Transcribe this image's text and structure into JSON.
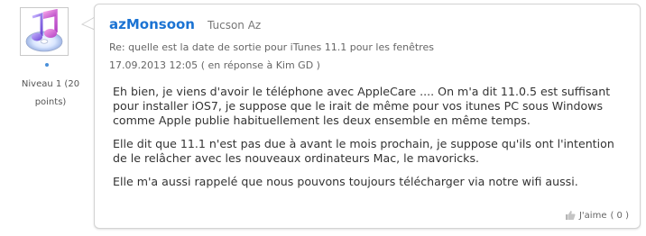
{
  "user": {
    "name": "azMonsoon",
    "location": "Tucson Az",
    "level": "Niveau 1 (20 points)",
    "avatar_icon": "music-notes-icon"
  },
  "post": {
    "subject": "Re: quelle est la date de sortie pour iTunes 11.1 pour les fenêtres",
    "date": "17.09.2013 12:05",
    "reply_prefix": "( en réponse à ",
    "reply_to": "Kim GD",
    "reply_suffix": " )",
    "paragraphs": [
      "Eh bien, je viens d'avoir le téléphone avec AppleCare .... On m'a dit 11.0.5 est suffisant pour installer iOS7, je suppose que le irait de même pour vos itunes PC sous Windows comme Apple publie habituellement les deux ensemble en même temps.",
      "Elle dit que 11.1 n'est pas due à avant le mois prochain, je suppose qu'ils ont l'intention de le relâcher avec les nouveaux ordinateurs Mac, le mavoricks.",
      "Elle m'a aussi rappelé que nous pouvons toujours télécharger via notre wifi aussi."
    ],
    "like_label": "J'aime",
    "like_count": "( 0 )"
  },
  "colors": {
    "author": "#1b73d3",
    "level_dot": "#4a90d9"
  }
}
